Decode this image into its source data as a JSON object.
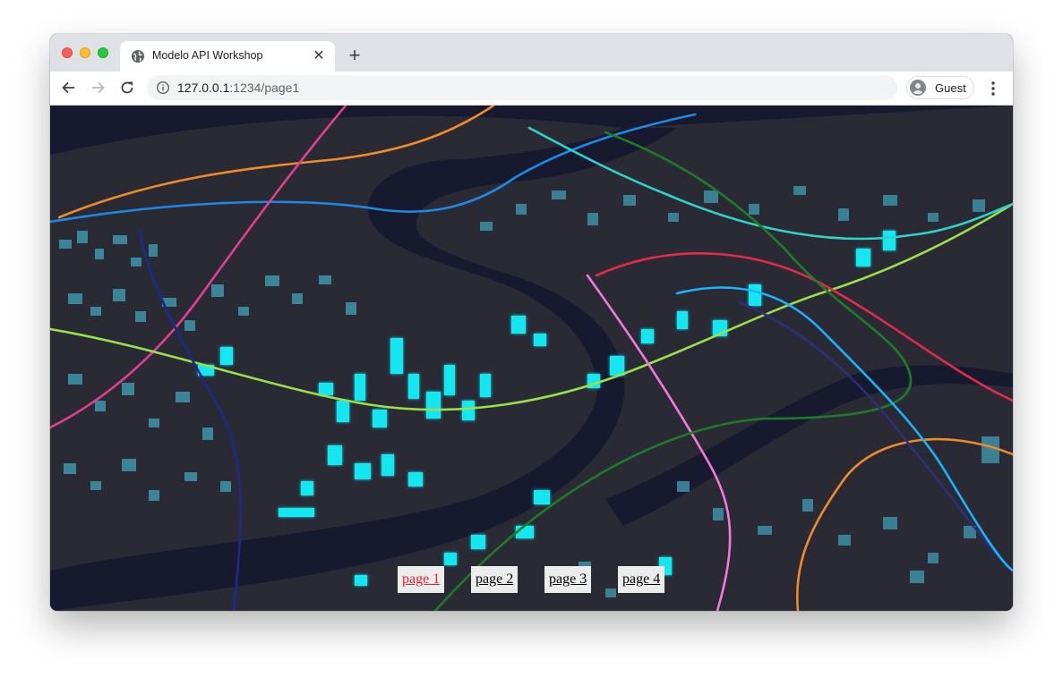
{
  "browser": {
    "tab_title": "Modelo API Workshop",
    "url_host": "127.0.0.1",
    "url_rest": ":1234/page1",
    "profile_name": "Guest",
    "icons": {
      "favicon": "globe-icon",
      "close": "close-icon",
      "new_tab": "plus-icon",
      "back": "back-arrow-icon",
      "forward": "forward-arrow-icon",
      "reload": "reload-icon",
      "site_info": "info-icon",
      "profile": "avatar-icon",
      "menu": "kebab-menu-icon"
    }
  },
  "page": {
    "nav": [
      {
        "label": "page 1",
        "active": true
      },
      {
        "label": "page 2",
        "active": false
      },
      {
        "label": "page 3",
        "active": false
      },
      {
        "label": "page 4",
        "active": false
      }
    ]
  },
  "colors": {
    "map_background": "#1b1c33",
    "land": "#2a2a35",
    "water": "#171a2e",
    "building": "#3f8fa3",
    "building_highlight": "#18e6f0",
    "active_link": "#e8202c"
  }
}
